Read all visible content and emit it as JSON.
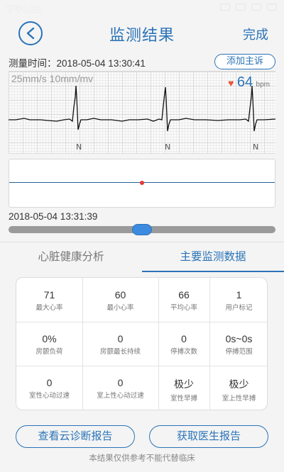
{
  "status_bar": {
    "time": "下午1:32"
  },
  "header": {
    "title": "监测结果",
    "done_label": "完成"
  },
  "measure": {
    "time_label": "测量时间：2018-05-04 13:30:41",
    "add_complaint_label": "添加主诉"
  },
  "ecg": {
    "scale_label": "25mm/s  10mm/mv",
    "heart_rate": "64",
    "heart_rate_unit": "bpm",
    "beat_labels": [
      "N",
      "N",
      "N"
    ]
  },
  "timeline": {
    "timestamp": "2018-05-04 13:31:39",
    "position": 0.5
  },
  "tabs": [
    {
      "label": "心脏健康分析",
      "active": false
    },
    {
      "label": "主要监测数据",
      "active": true
    }
  ],
  "stats": [
    {
      "value": "71",
      "label": "最大心率"
    },
    {
      "value": "60",
      "label": "最小心率"
    },
    {
      "value": "66",
      "label": "平均心率"
    },
    {
      "value": "1",
      "label": "用户标记"
    },
    {
      "value": "0%",
      "label": "房颤负荷"
    },
    {
      "value": "0",
      "label": "房颤最长持续"
    },
    {
      "value": "0",
      "label": "停搏次数"
    },
    {
      "value": "0s~0s",
      "label": "停搏范围"
    },
    {
      "value": "0",
      "label": "室性心动过速"
    },
    {
      "value": "0",
      "label": "室上性心动过速"
    },
    {
      "value": "极少",
      "label": "室性早搏"
    },
    {
      "value": "极少",
      "label": "室上性早搏"
    }
  ],
  "buttons": {
    "cloud_report": "查看云诊断报告",
    "doctor_report": "获取医生报告"
  },
  "disclaimer": "本结果仅供参考不能代替临床",
  "colors": {
    "accent": "#2a73b8",
    "heart": "#e8553a",
    "marker": "#e53935"
  }
}
